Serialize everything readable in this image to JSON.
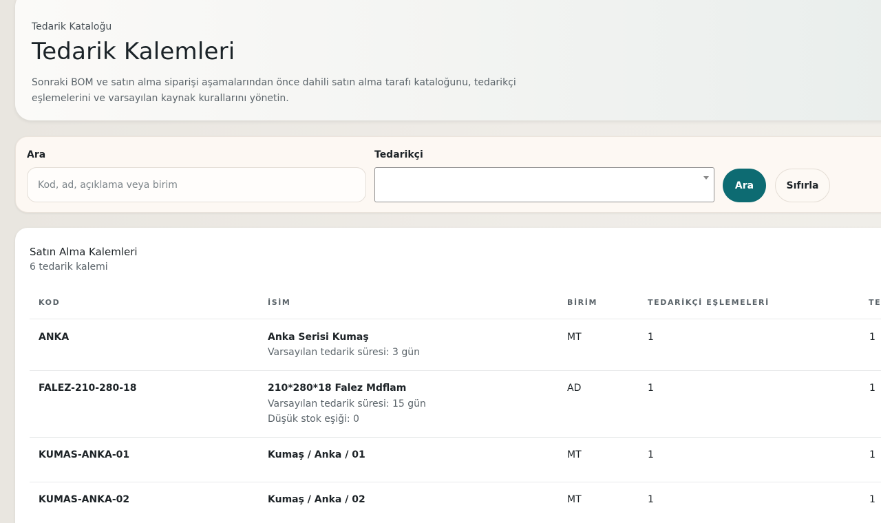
{
  "header": {
    "eyebrow": "Tedarik Kataloğu",
    "title": "Tedarik Kalemleri",
    "description_line1": "Sonraki BOM ve satın alma siparişi aşamalarından önce dahili satın alma tarafı kataloğunu, tedarikçi",
    "description_line2": "eşlemelerini ve varsayılan kaynak kurallarını yönetin."
  },
  "filters": {
    "search_label": "Ara",
    "search_placeholder": "Kod, ad, açıklama veya birim",
    "search_value": "",
    "supplier_label": "Tedarikçi",
    "supplier_value": "",
    "search_button": "Ara",
    "reset_button": "Sıfırla"
  },
  "table": {
    "title": "Satın Alma Kalemleri",
    "count": "6 tedarik kalemi",
    "columns": [
      "KOD",
      "İSİM",
      "BİRİM",
      "TEDARİKÇİ EŞLEMELERİ",
      "TE"
    ],
    "rows": [
      {
        "code": "ANKA",
        "name": "Anka Serisi Kumaş",
        "details": [
          "Varsayılan tedarik süresi: 3 gün"
        ],
        "unit": "MT",
        "mappings": "1",
        "extra": "1"
      },
      {
        "code": "FALEZ-210-280-18",
        "name": "210*280*18 Falez Mdflam",
        "details": [
          "Varsayılan tedarik süresi: 15 gün",
          "Düşük stok eşiği: 0"
        ],
        "unit": "AD",
        "mappings": "1",
        "extra": "1"
      },
      {
        "code": "KUMAS-ANKA-01",
        "name": "Kumaş / Anka / 01",
        "details": [],
        "unit": "MT",
        "mappings": "1",
        "extra": "1"
      },
      {
        "code": "KUMAS-ANKA-02",
        "name": "Kumaş / Anka / 02",
        "details": [],
        "unit": "MT",
        "mappings": "1",
        "extra": "1"
      }
    ]
  },
  "colors": {
    "accent": "#0d6b72",
    "page_background": "#ebe8e3"
  }
}
